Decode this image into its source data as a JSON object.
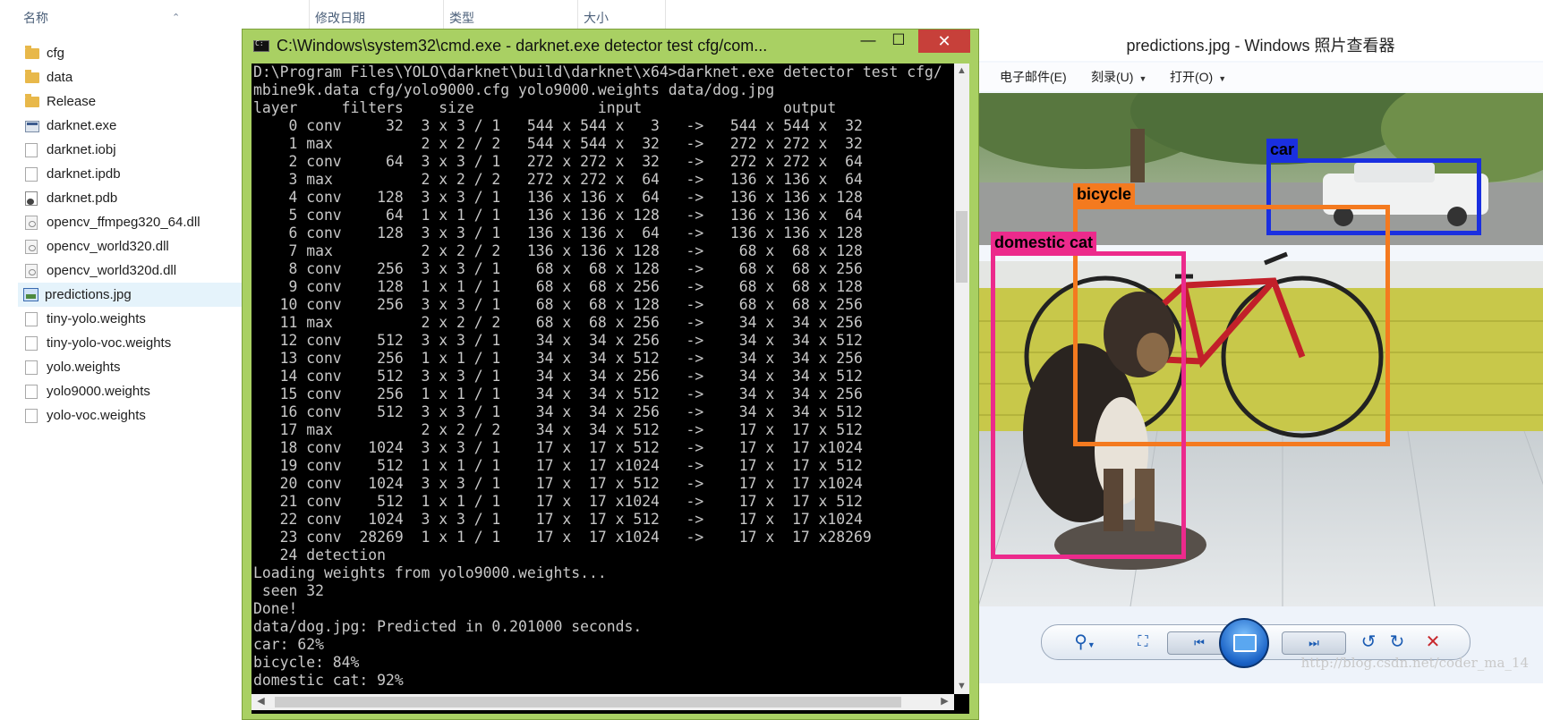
{
  "explorer": {
    "columns": {
      "name": "名称",
      "modified": "修改日期",
      "type": "类型",
      "size": "大小"
    },
    "sort_indicator": "⌃",
    "files": [
      {
        "name": "cfg",
        "icon": "folder-icon"
      },
      {
        "name": "data",
        "icon": "folder-icon"
      },
      {
        "name": "Release",
        "icon": "folder-icon"
      },
      {
        "name": "darknet.exe",
        "icon": "exe-icon"
      },
      {
        "name": "darknet.iobj",
        "icon": "file-icon"
      },
      {
        "name": "darknet.ipdb",
        "icon": "file-icon"
      },
      {
        "name": "darknet.pdb",
        "icon": "pdb-icon"
      },
      {
        "name": "opencv_ffmpeg320_64.dll",
        "icon": "dll-icon"
      },
      {
        "name": "opencv_world320.dll",
        "icon": "dll-icon"
      },
      {
        "name": "opencv_world320d.dll",
        "icon": "dll-icon"
      },
      {
        "name": "predictions.jpg",
        "icon": "image-file-icon",
        "selected": true
      },
      {
        "name": "tiny-yolo.weights",
        "icon": "file-icon"
      },
      {
        "name": "tiny-yolo-voc.weights",
        "icon": "file-icon"
      },
      {
        "name": "yolo.weights",
        "icon": "file-icon"
      },
      {
        "name": "yolo9000.weights",
        "icon": "file-icon"
      },
      {
        "name": "yolo-voc.weights",
        "icon": "file-icon"
      }
    ]
  },
  "cmd": {
    "title": "C:\\Windows\\system32\\cmd.exe - darknet.exe  detector test cfg/com...",
    "minimize": "—",
    "maximize": "☐",
    "close": "✕",
    "lines": [
      "D:\\Program Files\\YOLO\\darknet\\build\\darknet\\x64>darknet.exe detector test cfg/",
      "mbine9k.data cfg/yolo9000.cfg yolo9000.weights data/dog.jpg",
      "layer     filters    size              input                output",
      "    0 conv     32  3 x 3 / 1   544 x 544 x   3   ->   544 x 544 x  32",
      "    1 max          2 x 2 / 2   544 x 544 x  32   ->   272 x 272 x  32",
      "    2 conv     64  3 x 3 / 1   272 x 272 x  32   ->   272 x 272 x  64",
      "    3 max          2 x 2 / 2   272 x 272 x  64   ->   136 x 136 x  64",
      "    4 conv    128  3 x 3 / 1   136 x 136 x  64   ->   136 x 136 x 128",
      "    5 conv     64  1 x 1 / 1   136 x 136 x 128   ->   136 x 136 x  64",
      "    6 conv    128  3 x 3 / 1   136 x 136 x  64   ->   136 x 136 x 128",
      "    7 max          2 x 2 / 2   136 x 136 x 128   ->    68 x  68 x 128",
      "    8 conv    256  3 x 3 / 1    68 x  68 x 128   ->    68 x  68 x 256",
      "    9 conv    128  1 x 1 / 1    68 x  68 x 256   ->    68 x  68 x 128",
      "   10 conv    256  3 x 3 / 1    68 x  68 x 128   ->    68 x  68 x 256",
      "   11 max          2 x 2 / 2    68 x  68 x 256   ->    34 x  34 x 256",
      "   12 conv    512  3 x 3 / 1    34 x  34 x 256   ->    34 x  34 x 512",
      "   13 conv    256  1 x 1 / 1    34 x  34 x 512   ->    34 x  34 x 256",
      "   14 conv    512  3 x 3 / 1    34 x  34 x 256   ->    34 x  34 x 512",
      "   15 conv    256  1 x 1 / 1    34 x  34 x 512   ->    34 x  34 x 256",
      "   16 conv    512  3 x 3 / 1    34 x  34 x 256   ->    34 x  34 x 512",
      "   17 max          2 x 2 / 2    34 x  34 x 512   ->    17 x  17 x 512",
      "   18 conv   1024  3 x 3 / 1    17 x  17 x 512   ->    17 x  17 x1024",
      "   19 conv    512  1 x 1 / 1    17 x  17 x1024   ->    17 x  17 x 512",
      "   20 conv   1024  3 x 3 / 1    17 x  17 x 512   ->    17 x  17 x1024",
      "   21 conv    512  1 x 1 / 1    17 x  17 x1024   ->    17 x  17 x 512",
      "   22 conv   1024  3 x 3 / 1    17 x  17 x 512   ->    17 x  17 x1024",
      "   23 conv  28269  1 x 1 / 1    17 x  17 x1024   ->    17 x  17 x28269",
      "   24 detection",
      "Loading weights from yolo9000.weights...",
      " seen 32",
      "Done!",
      "data/dog.jpg: Predicted in 0.201000 seconds.",
      "car: 62%",
      "bicycle: 84%",
      "domestic cat: 92%"
    ]
  },
  "viewer": {
    "title": "predictions.jpg - Windows 照片查看器",
    "menu": [
      {
        "label": "电子邮件(E)",
        "dropdown": false
      },
      {
        "label": "刻录(U)",
        "dropdown": true
      },
      {
        "label": "打开(O)",
        "dropdown": true
      }
    ],
    "detections": [
      {
        "label": "car",
        "color": "#1a2fe0"
      },
      {
        "label": "bicycle",
        "color": "#f47a1f"
      },
      {
        "label": "domestic cat",
        "color": "#ec2a8c"
      }
    ],
    "watermark": "http://blog.csdn.net/coder_ma_14"
  }
}
